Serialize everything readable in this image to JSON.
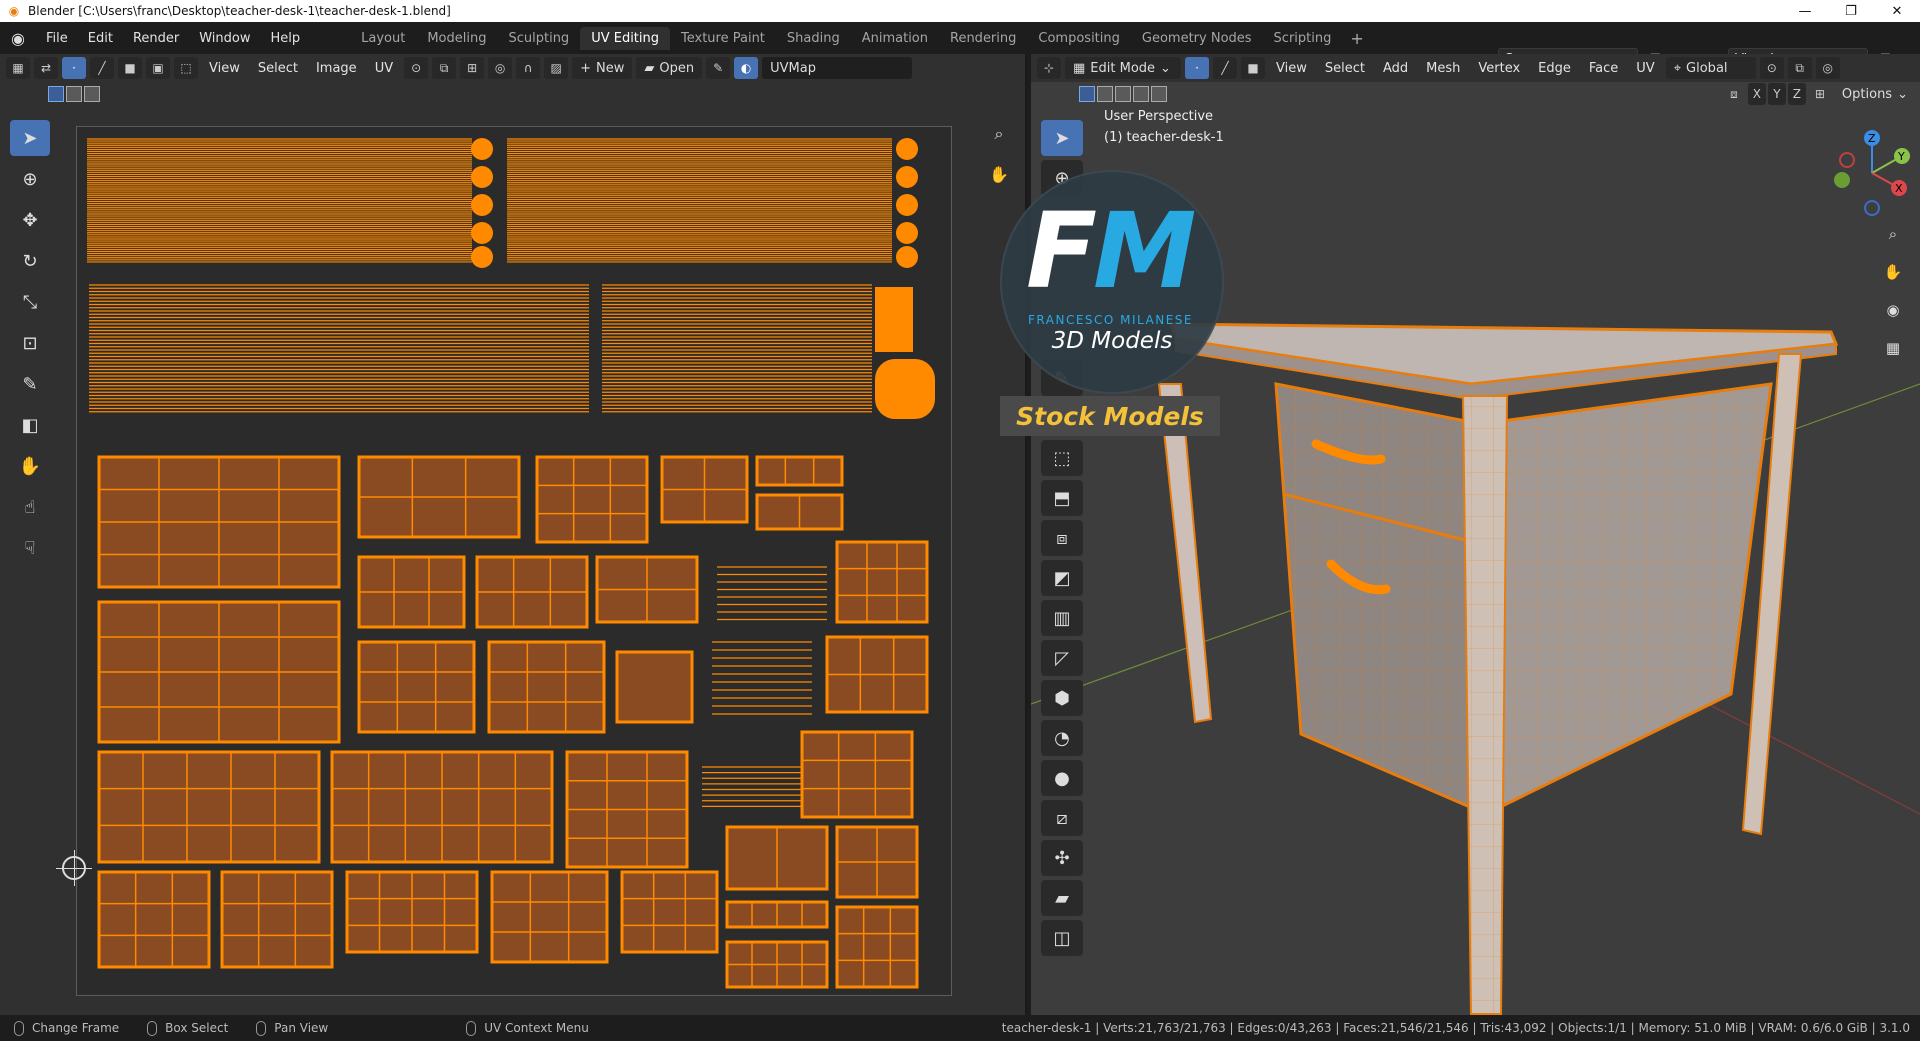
{
  "window": {
    "title": "Blender [C:\\Users\\franc\\Desktop\\teacher-desk-1\\teacher-desk-1.blend]",
    "minimize": "—",
    "maximize": "❐",
    "close": "✕"
  },
  "menus": [
    "File",
    "Edit",
    "Render",
    "Window",
    "Help"
  ],
  "workspaces": [
    "Layout",
    "Modeling",
    "Sculpting",
    "UV Editing",
    "Texture Paint",
    "Shading",
    "Animation",
    "Rendering",
    "Compositing",
    "Geometry Nodes",
    "Scripting"
  ],
  "active_workspace": "UV Editing",
  "scene": {
    "name": "Scene",
    "view_layer": "View Layer"
  },
  "uv_editor": {
    "menus": [
      "View",
      "Select",
      "Image",
      "UV"
    ],
    "new_label": "New",
    "open_label": "Open",
    "uvmap": "UVMap"
  },
  "viewport": {
    "mode": "Edit Mode",
    "menus": [
      "View",
      "Select",
      "Add",
      "Mesh",
      "Vertex",
      "Edge",
      "Face",
      "UV"
    ],
    "orientation": "Global",
    "options_label": "Options",
    "axes": [
      "X",
      "Y",
      "Z"
    ],
    "perspective": "User Perspective",
    "object_label": "(1) teacher-desk-1"
  },
  "watermark": {
    "initial_f": "F",
    "initial_m": "M",
    "name": "FRANCESCO MILANESE",
    "line": "3D Models",
    "stock": "Stock Models"
  },
  "status": {
    "items": [
      "Change Frame",
      "Box Select",
      "Pan View",
      "UV Context Menu"
    ],
    "stats": "teacher-desk-1 | Verts:21,763/21,763 | Edges:0/43,263 | Faces:21,546/21,546 | Tris:43,092 | Objects:1/1 | Memory: 51.0 MiB | VRAM: 0.6/6.0 GiB | 3.1.0"
  },
  "colors": {
    "accent": "#4772b3",
    "uv_orange": "#ff8a00",
    "uv_fill": "#8a4a22",
    "wm_blue": "#29a9e1",
    "wm_yellow": "#f4c13a"
  }
}
